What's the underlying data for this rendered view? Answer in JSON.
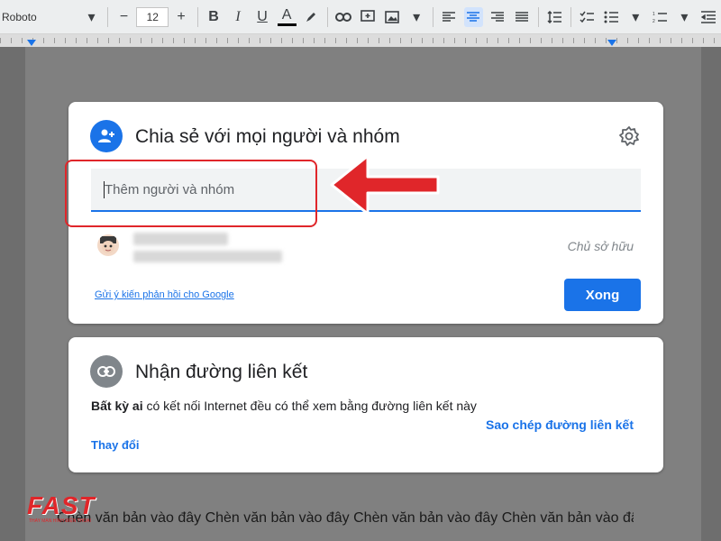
{
  "toolbar": {
    "font_name": "Roboto",
    "font_size": "12",
    "minus": "−",
    "plus": "+",
    "bold": "B",
    "italic": "I",
    "underline": "U",
    "text_color": "A"
  },
  "share_dialog": {
    "title": "Chia sẻ với mọi người và nhóm",
    "input_placeholder": "Thêm người và nhóm",
    "owner_label": "Chủ sở hữu",
    "feedback_link": "Gửi ý kiến phản hồi cho Google",
    "done_button": "Xong"
  },
  "link_dialog": {
    "title": "Nhận đường liên kết",
    "description_bold": "Bất kỳ ai",
    "description_rest": " có kết nối Internet đều có thể xem bằng đường liên kết này",
    "change_link": "Thay đổi",
    "copy_link": "Sao chép đường liên kết"
  },
  "document": {
    "body_text": "Chèn văn bản vào đây Chèn văn bản vào đây Chèn văn bản vào đây Chèn văn bản vào đây Chèn văn bản vào đây Chèn văn bản vào đây Chèn văn bản vào đây Chèn"
  },
  "watermark": {
    "logo_text": "FAST",
    "logo_subtext": "THAY MÀN HÌNH ĐIỆN THOẠI"
  },
  "colors": {
    "accent": "#1a73e8",
    "highlight_red": "#e0262a",
    "link_icon_gray": "#80868b"
  }
}
